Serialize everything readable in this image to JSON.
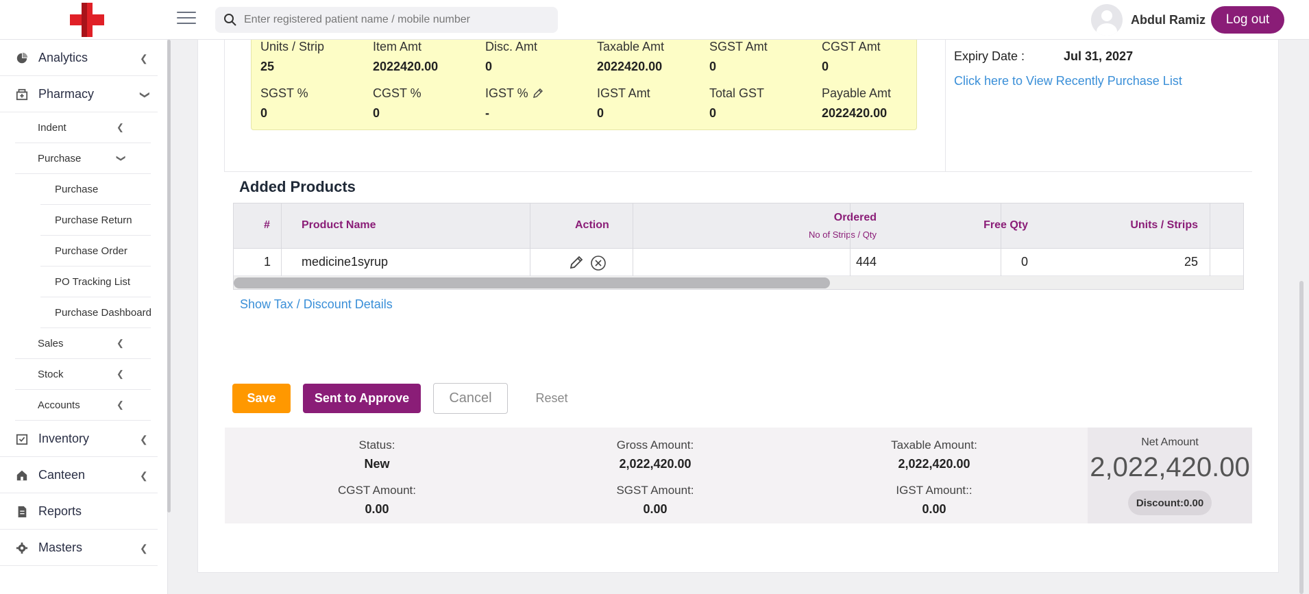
{
  "header": {
    "search_placeholder": "Enter registered patient name / mobile number",
    "username": "Abdul Ramiz",
    "logout_label": "Log out"
  },
  "sidebar": {
    "items": [
      {
        "label": "Analytics",
        "icon": "pie-chart-icon"
      },
      {
        "label": "Pharmacy",
        "icon": "pharmacy-icon"
      },
      {
        "label": "Inventory",
        "icon": "inventory-icon"
      },
      {
        "label": "Canteen",
        "icon": "canteen-icon"
      },
      {
        "label": "Reports",
        "icon": "report-icon"
      },
      {
        "label": "Masters",
        "icon": "gear-icon"
      }
    ],
    "pharmacy_sub": [
      {
        "label": "Indent"
      },
      {
        "label": "Purchase"
      },
      {
        "label": "Sales"
      },
      {
        "label": "Stock"
      },
      {
        "label": "Accounts"
      }
    ],
    "purchase_sub": [
      {
        "label": "Purchase"
      },
      {
        "label": "Purchase Return"
      },
      {
        "label": "Purchase Order"
      },
      {
        "label": "PO Tracking List"
      },
      {
        "label": "Purchase Dashboard"
      }
    ]
  },
  "item_summary": {
    "row1": [
      {
        "label": "Units / Strip",
        "value": "25"
      },
      {
        "label": "Item Amt",
        "value": "2022420.00"
      },
      {
        "label": "Disc. Amt",
        "value": "0"
      },
      {
        "label": "Taxable Amt",
        "value": "2022420.00"
      },
      {
        "label": "SGST Amt",
        "value": "0"
      },
      {
        "label": "CGST Amt",
        "value": "0"
      }
    ],
    "row2": [
      {
        "label": "SGST %",
        "value": "0"
      },
      {
        "label": "CGST %",
        "value": "0"
      },
      {
        "label": "IGST %",
        "value": "-"
      },
      {
        "label": "IGST Amt",
        "value": "0"
      },
      {
        "label": "Total GST",
        "value": "0"
      },
      {
        "label": "Payable Amt",
        "value": "2022420.00"
      }
    ]
  },
  "batch_info": {
    "expiry_label": "Expiry Date :",
    "expiry_value": "Jul 31, 2027",
    "recent_purchase_link": "Click here to View Recently Purchase List"
  },
  "added_products": {
    "title": "Added Products",
    "columns": {
      "num": "#",
      "product_name": "Product Name",
      "action": "Action",
      "ordered": "Ordered",
      "ordered_sub": "No of Strips / Qty",
      "free_qty": "Free Qty",
      "units_strips": "Units / Strips"
    },
    "rows": [
      {
        "num": "1",
        "product_name": "medicine1syrup",
        "ordered": "444",
        "free_qty": "0",
        "units_strips": "25"
      }
    ],
    "show_tax_link": "Show Tax / Discount Details"
  },
  "actions": {
    "save": "Save",
    "send_approve": "Sent to Approve",
    "cancel": "Cancel",
    "reset": "Reset"
  },
  "totals": {
    "status_label": "Status:",
    "status_value": "New",
    "gross_label": "Gross Amount:",
    "gross_value": "2,022,420.00",
    "taxable_label": "Taxable Amount:",
    "taxable_value": "2,022,420.00",
    "cgst_label": "CGST Amount:",
    "cgst_value": "0.00",
    "sgst_label": "SGST Amount:",
    "sgst_value": "0.00",
    "igst_label": "IGST Amount::",
    "igst_value": "0.00",
    "net_label": "Net Amount",
    "net_value": "2,022,420.00",
    "discount": "Discount:0.00"
  },
  "colors": {
    "brand": "#8a1d77",
    "save": "#ff9800",
    "link": "#3a8fd8",
    "highlight_panel": "#fdfdc6"
  }
}
